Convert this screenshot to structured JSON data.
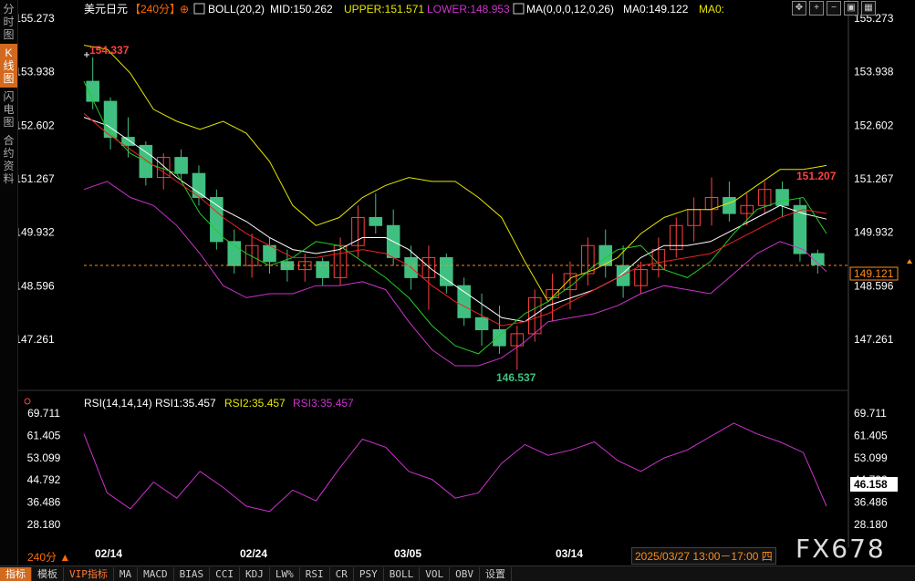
{
  "sidebar": {
    "tabs": [
      {
        "label": "分时图",
        "active": false
      },
      {
        "label": "K线图",
        "active": true
      },
      {
        "label": "闪电图",
        "active": false
      },
      {
        "label": "合约资料",
        "active": false
      }
    ]
  },
  "header": {
    "symbol": "美元日元",
    "period": "【240分】",
    "boll_name": "BOLL(20,2)",
    "mid": "MID:150.262",
    "upper": "UPPER:151.571",
    "lower": "LOWER:148.953",
    "ma_name": "MA(0,0,0,12,0,26)",
    "ma0": "MA0:149.122",
    "ma0b": "MA0:"
  },
  "rsi_header": {
    "name": "RSI(14,14,14)",
    "rsi1": "RSI1:35.457",
    "rsi2": "RSI2:35.457",
    "rsi3": "RSI3:35.457"
  },
  "price_axis": [
    "155.273",
    "153.938",
    "152.602",
    "151.267",
    "149.932",
    "148.596",
    "147.261"
  ],
  "rsi_axis": [
    "69.711",
    "61.405",
    "53.099",
    "44.792",
    "36.486",
    "28.180"
  ],
  "current_price": "149.121",
  "current_rsi": "46.158",
  "annotations": {
    "high1": "154.337",
    "low": "146.537",
    "high2": "151.207"
  },
  "dates": [
    "02/14",
    "02/24",
    "03/05",
    "03/14"
  ],
  "datetime": "2025/03/27 13:00－17:00 四",
  "period_label": "240分 ▲",
  "watermark": "FX678",
  "bottom_tabs": [
    "指标",
    "模板",
    "VIP指标",
    "MA",
    "MACD",
    "BIAS",
    "CCI",
    "KDJ",
    "LW%",
    "RSI",
    "CR",
    "PSY",
    "BOLL",
    "VOL",
    "OBV",
    "设置"
  ],
  "toolbar_icons": [
    "move-icon",
    "zoom-in-icon",
    "zoom-out-icon",
    "lock-icon",
    "grid-icon"
  ],
  "colors": {
    "up": "#ff4040",
    "down": "#40c080",
    "boll_upper": "#e6e600",
    "boll_lower": "#cc33cc",
    "boll_mid": "#ffffff",
    "ma12": "#22cc22",
    "ma26": "#ee2222",
    "rsi": "#cc33cc",
    "accent": "#d2691e"
  },
  "chart_data": {
    "type": "line",
    "title": "美元日元 240分",
    "price_range": [
      146.3,
      155.4
    ],
    "rsi_range": [
      25,
      72
    ],
    "series": [
      {
        "name": "UPPER",
        "values": [
          154.6,
          154.5,
          153.9,
          153.0,
          152.7,
          152.5,
          152.7,
          152.4,
          151.7,
          150.6,
          150.1,
          150.3,
          150.8,
          151.1,
          151.3,
          151.2,
          151.2,
          150.8,
          150.3,
          149.2,
          148.2,
          148.8,
          149.0,
          149.3,
          149.9,
          150.3,
          150.5,
          150.5,
          150.7,
          151.1,
          151.5,
          151.5,
          151.6
        ]
      },
      {
        "name": "MID",
        "values": [
          152.8,
          152.6,
          152.2,
          151.8,
          151.3,
          150.9,
          150.5,
          150.2,
          149.8,
          149.5,
          149.4,
          149.5,
          149.8,
          149.8,
          149.5,
          149.0,
          148.6,
          148.2,
          147.8,
          147.7,
          148.1,
          148.3,
          148.5,
          148.8,
          149.3,
          149.6,
          149.6,
          149.7,
          150.0,
          150.3,
          150.6,
          150.4,
          150.26
        ]
      },
      {
        "name": "LOWER",
        "values": [
          151.0,
          151.2,
          150.8,
          150.6,
          150.1,
          149.4,
          148.6,
          148.3,
          148.4,
          148.4,
          148.6,
          148.6,
          148.7,
          148.5,
          147.7,
          147.0,
          146.6,
          146.6,
          146.8,
          147.2,
          147.7,
          147.8,
          147.9,
          148.1,
          148.4,
          148.6,
          148.5,
          148.4,
          148.9,
          149.4,
          149.7,
          149.5,
          148.95
        ]
      },
      {
        "name": "MA12",
        "values": [
          153.7,
          152.5,
          151.9,
          151.6,
          151.4,
          150.4,
          149.8,
          149.4,
          149.1,
          149.3,
          149.7,
          149.6,
          149.2,
          148.8,
          148.3,
          147.6,
          147.1,
          146.9,
          147.4,
          147.9,
          148.2,
          148.6,
          149.1,
          149.5,
          149.6,
          149.0,
          148.8,
          149.2,
          149.9,
          150.5,
          150.7,
          150.8,
          149.9
        ]
      },
      {
        "name": "MA26",
        "values": [
          152.9,
          152.4,
          152.0,
          151.6,
          151.2,
          150.8,
          150.3,
          149.9,
          149.6,
          149.3,
          149.3,
          149.4,
          149.5,
          149.4,
          149.1,
          148.6,
          148.2,
          147.9,
          147.6,
          147.7,
          147.9,
          148.2,
          148.5,
          148.8,
          149.1,
          149.2,
          149.3,
          149.4,
          149.7,
          150.0,
          150.3,
          150.5,
          150.4
        ]
      },
      {
        "name": "RSI1",
        "values": [
          62,
          40,
          34,
          44,
          38,
          48,
          42,
          35,
          33,
          41,
          37,
          49,
          60,
          57,
          48,
          45,
          38,
          40,
          51,
          58,
          54,
          56,
          59,
          52,
          48,
          53,
          56,
          61,
          66,
          62,
          59,
          55,
          35
        ]
      }
    ],
    "candles": [
      [
        153.7,
        154.3,
        153.0,
        153.2
      ],
      [
        153.2,
        153.3,
        152.0,
        152.3
      ],
      [
        152.3,
        152.8,
        151.8,
        152.1
      ],
      [
        152.1,
        152.2,
        151.1,
        151.3
      ],
      [
        151.3,
        151.9,
        151.0,
        151.8
      ],
      [
        151.8,
        152.0,
        151.2,
        151.4
      ],
      [
        151.4,
        151.6,
        150.6,
        150.8
      ],
      [
        150.8,
        151.0,
        149.5,
        149.7
      ],
      [
        149.7,
        150.0,
        148.9,
        149.1
      ],
      [
        149.1,
        149.9,
        148.8,
        149.6
      ],
      [
        149.6,
        149.8,
        148.9,
        149.2
      ],
      [
        149.2,
        149.5,
        148.7,
        149.0
      ],
      [
        149.0,
        149.4,
        148.7,
        149.2
      ],
      [
        149.2,
        149.3,
        148.6,
        148.8
      ],
      [
        148.8,
        149.8,
        148.6,
        149.6
      ],
      [
        149.6,
        150.6,
        149.3,
        150.3
      ],
      [
        150.3,
        150.9,
        149.9,
        150.1
      ],
      [
        150.1,
        150.5,
        149.1,
        149.3
      ],
      [
        149.3,
        149.6,
        148.5,
        148.8
      ],
      [
        148.8,
        149.6,
        148.0,
        149.3
      ],
      [
        149.3,
        149.4,
        148.4,
        148.6
      ],
      [
        148.6,
        148.8,
        147.6,
        147.8
      ],
      [
        147.8,
        148.4,
        147.1,
        147.5
      ],
      [
        147.5,
        148.1,
        146.9,
        147.1
      ],
      [
        147.1,
        147.6,
        146.5,
        147.4
      ],
      [
        147.4,
        148.5,
        147.2,
        148.3
      ],
      [
        148.3,
        148.9,
        147.7,
        148.5
      ],
      [
        148.5,
        149.2,
        148.0,
        148.9
      ],
      [
        148.9,
        149.8,
        148.6,
        149.6
      ],
      [
        149.6,
        150.0,
        148.8,
        149.1
      ],
      [
        149.1,
        149.6,
        148.3,
        148.6
      ],
      [
        148.6,
        149.2,
        148.4,
        149.0
      ],
      [
        149.0,
        149.8,
        148.8,
        149.5
      ],
      [
        149.5,
        150.3,
        149.3,
        150.1
      ],
      [
        150.1,
        150.8,
        149.7,
        150.5
      ],
      [
        150.5,
        151.3,
        150.1,
        150.8
      ],
      [
        150.8,
        151.2,
        150.2,
        150.4
      ],
      [
        150.4,
        150.9,
        150.1,
        150.6
      ],
      [
        150.6,
        151.2,
        150.4,
        151.0
      ],
      [
        151.0,
        151.2,
        150.3,
        150.6
      ],
      [
        150.6,
        150.8,
        149.2,
        149.4
      ],
      [
        149.4,
        149.5,
        148.9,
        149.121
      ]
    ]
  }
}
